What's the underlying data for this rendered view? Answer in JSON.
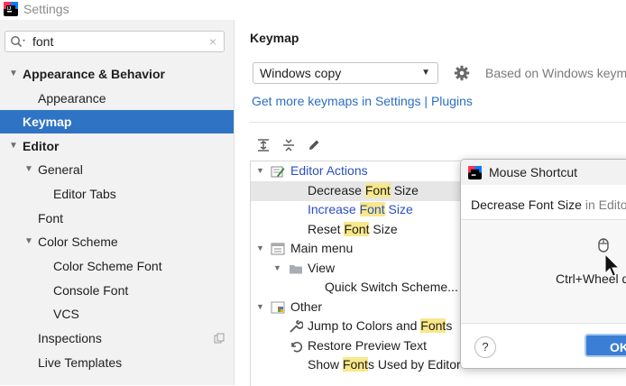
{
  "window": {
    "title": "Settings",
    "app_icon": "intellij-logo-icon"
  },
  "sidebar": {
    "search": {
      "value": "font",
      "clear_icon": "×"
    },
    "items": [
      {
        "label": "Appearance & Behavior",
        "level": 0,
        "expanded": true,
        "bold": true
      },
      {
        "label": "Appearance",
        "level": 1
      },
      {
        "label": "Keymap",
        "level": 0,
        "bold": true,
        "selected": true
      },
      {
        "label": "Editor",
        "level": 0,
        "expanded": true,
        "bold": true
      },
      {
        "label": "General",
        "level": 1,
        "expanded": true
      },
      {
        "label": "Editor Tabs",
        "level": 2
      },
      {
        "label": "Font",
        "level": 1
      },
      {
        "label": "Color Scheme",
        "level": 1,
        "expanded": true
      },
      {
        "label": "Color Scheme Font",
        "level": 2
      },
      {
        "label": "Console Font",
        "level": 2
      },
      {
        "label": "VCS",
        "level": 2
      },
      {
        "label": "Inspections",
        "level": 1
      },
      {
        "label": "Live Templates",
        "level": 1
      }
    ]
  },
  "main": {
    "title": "Keymap",
    "keymap_select": {
      "value": "Windows copy"
    },
    "based_on": "Based on Windows keyma",
    "more_link": "Get more keymaps in Settings | Plugins",
    "toolbar": [
      "expand-all-icon",
      "collapse-all-icon",
      "edit-pencil-icon"
    ],
    "tree": [
      {
        "parts": [
          {
            "t": "Editor Actions"
          }
        ],
        "color": "blue",
        "level": 0,
        "expanded": true,
        "icon": "editor-actions-icon"
      },
      {
        "parts": [
          {
            "t": "Decrease "
          },
          {
            "t": "Font",
            "hl": true
          },
          {
            "t": " Size"
          }
        ],
        "level": 1,
        "selected": true
      },
      {
        "parts": [
          {
            "t": "Increase "
          },
          {
            "t": "Font",
            "hl": true
          },
          {
            "t": " Size"
          }
        ],
        "color": "blue",
        "level": 1
      },
      {
        "parts": [
          {
            "t": "Reset "
          },
          {
            "t": "Font",
            "hl": true
          },
          {
            "t": " Size"
          }
        ],
        "level": 1
      },
      {
        "parts": [
          {
            "t": "Main menu"
          }
        ],
        "level": 0,
        "expanded": true,
        "icon": "menu-icon"
      },
      {
        "parts": [
          {
            "t": "View"
          }
        ],
        "level": 1,
        "expanded": true,
        "icon": "folder-icon"
      },
      {
        "parts": [
          {
            "t": "Quick Switch Scheme..."
          }
        ],
        "level": 2
      },
      {
        "parts": [
          {
            "t": "Other"
          }
        ],
        "level": 0,
        "expanded": true,
        "icon": "other-icon"
      },
      {
        "parts": [
          {
            "t": "Jump to Colors and "
          },
          {
            "t": "Font",
            "hl": true
          },
          {
            "t": "s"
          }
        ],
        "level": 1,
        "icon": "wrench-icon"
      },
      {
        "parts": [
          {
            "t": "Restore Preview Text"
          }
        ],
        "level": 1,
        "icon": "undo-icon"
      },
      {
        "parts": [
          {
            "t": "Show "
          },
          {
            "t": "Font",
            "hl": true
          },
          {
            "t": "s Used by Editor"
          }
        ],
        "level": 1
      }
    ]
  },
  "dialog": {
    "title": "Mouse Shortcut",
    "action": "Decrease Font Size",
    "context": " in Editor",
    "shortcut": "Ctrl+Wheel d",
    "help_label": "?",
    "ok_label": "OK"
  },
  "colors": {
    "accent": "#2f73c4",
    "link": "#2c6ec4",
    "highlight": "#f8e889"
  }
}
